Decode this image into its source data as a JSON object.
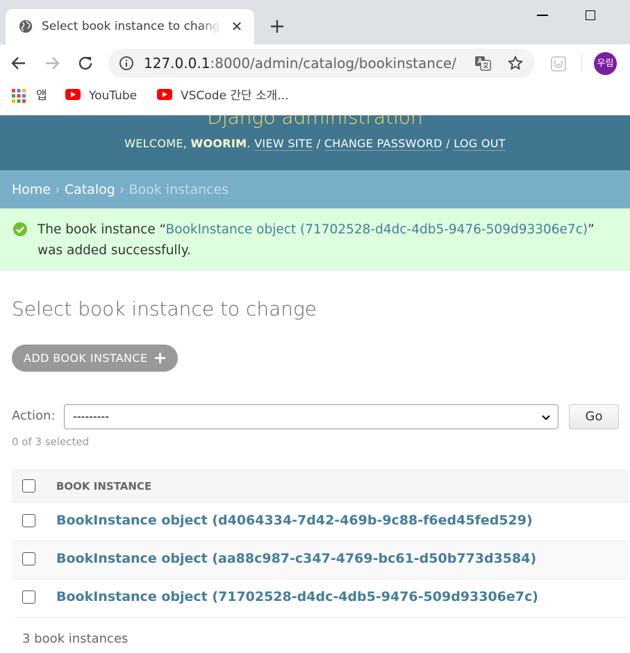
{
  "browser": {
    "tab_title": "Select book instance to change",
    "url_host": "127.0.0.1",
    "url_rest": ":8000/admin/catalog/bookinstance/",
    "profile_initials": "우림"
  },
  "bookmarks": [
    {
      "label": "앱",
      "icon": "apps-grid-icon"
    },
    {
      "label": "YouTube",
      "icon": "youtube-icon"
    },
    {
      "label": "VSCode 간단 소개...",
      "icon": "youtube-icon"
    }
  ],
  "admin": {
    "site_name": "Django administration",
    "welcome": "WELCOME,",
    "username": "WOORIM",
    "view_site": "VIEW SITE",
    "change_password": "CHANGE PASSWORD",
    "log_out": "LOG OUT",
    "slash": "/"
  },
  "breadcrumbs": {
    "home": "Home",
    "catalog": "Catalog",
    "current": "Book instances",
    "separator": "›"
  },
  "message": {
    "prefix": "The book instance “",
    "link": "BookInstance object (71702528-d4dc-4db5-9476-509d93306e7c)",
    "suffix": "” was added successfully."
  },
  "page_title": "Select book instance to change",
  "add_button": "ADD BOOK INSTANCE",
  "actions": {
    "label": "Action:",
    "selected": "---------",
    "go": "Go",
    "count": "0 of 3 selected"
  },
  "table": {
    "column": "BOOK INSTANCE",
    "rows": [
      "BookInstance object (d4064334-7d42-469b-9c88-f6ed45fed529)",
      "BookInstance object (aa88c987-c347-4769-bc61-d50b773d3584)",
      "BookInstance object (71702528-d4dc-4db5-9476-509d93306e7c)"
    ]
  },
  "paginator": "3 book instances",
  "colors": {
    "header": "#417690",
    "breadcrumbs": "#79aec8",
    "success": "#ddffdd",
    "link": "#447e9b"
  }
}
